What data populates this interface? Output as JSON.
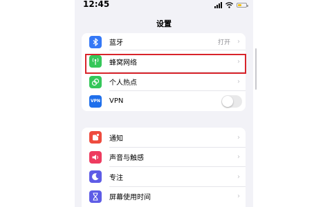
{
  "status_bar": {
    "time": "12:45"
  },
  "nav": {
    "title": "设置"
  },
  "groups": [
    {
      "items": [
        {
          "label": "蓝牙",
          "value": "打开",
          "icon": "bluetooth-icon",
          "color": "#3478f6"
        },
        {
          "label": "蜂窝网络",
          "icon": "cellular-icon",
          "color": "#34c759",
          "highlighted": true
        },
        {
          "label": "个人热点",
          "icon": "hotspot-icon",
          "color": "#34c759"
        },
        {
          "label": "VPN",
          "icon_text": "VPN",
          "icon": "vpn-icon",
          "color": "#1f6feb",
          "toggle": false
        }
      ]
    },
    {
      "items": [
        {
          "label": "通知",
          "icon": "notification-icon",
          "color": "#ee4b3e"
        },
        {
          "label": "声音与触感",
          "icon": "sound-icon",
          "color": "#ee3b5f"
        },
        {
          "label": "专注",
          "icon": "focus-moon-icon",
          "color": "#5e5ce6"
        },
        {
          "label": "屏幕使用时间",
          "icon": "screen-time-icon",
          "color": "#5e5ce6"
        }
      ]
    }
  ],
  "colors": {
    "highlight_border": "#d8232a",
    "background": "#f2f2f7"
  }
}
